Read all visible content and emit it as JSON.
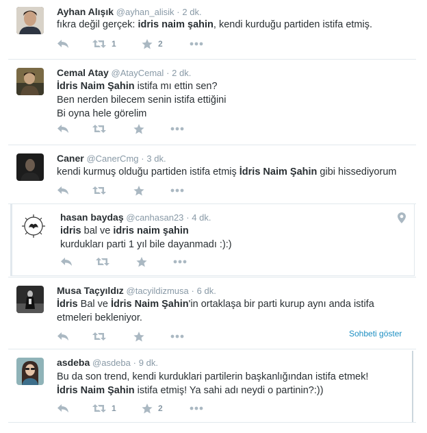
{
  "tweets": [
    {
      "name": "Ayhan Alışık",
      "handle": "@ayhan_alisik",
      "time": "2 dk.",
      "lines": [
        [
          {
            "t": "fıkra değil gerçek: ",
            "b": false
          },
          {
            "t": "idris naim şahin",
            "b": true
          },
          {
            "t": ", kendi kurduğu partiden istifa etmiş.",
            "b": false
          }
        ]
      ],
      "retweets": "1",
      "favorites": "2"
    },
    {
      "name": "Cemal Atay",
      "handle": "@AtayCemal",
      "time": "2 dk.",
      "lines": [
        [
          {
            "t": "İdris Naim Şahin",
            "b": true
          },
          {
            "t": " istifa mı ettin sen?",
            "b": false
          }
        ],
        [
          {
            "t": "Ben nerden bilecem senin istifa ettiğini",
            "b": false
          }
        ],
        [
          {
            "t": "Bi oyna hele görelim",
            "b": false
          }
        ]
      ],
      "retweets": "",
      "favorites": ""
    },
    {
      "name": "Caner",
      "handle": "@CanerCmg",
      "time": "3 dk.",
      "lines": [
        [
          {
            "t": "kendi kurmuş olduğu partiden istifa etmiş ",
            "b": false
          },
          {
            "t": "İdris Naim Şahin",
            "b": true
          },
          {
            "t": " gibi hissediyorum",
            "b": false
          }
        ]
      ],
      "retweets": "",
      "favorites": ""
    },
    {
      "name": "hasan baydaş",
      "handle": "@canhasan23",
      "time": "4 dk.",
      "lines": [
        [
          {
            "t": "idris",
            "b": true
          },
          {
            "t": " bal ve ",
            "b": false
          },
          {
            "t": "idris naim şahin",
            "b": true
          }
        ],
        [
          {
            "t": "kurdukları parti 1 yıl bile dayanmadı :):)",
            "b": false
          }
        ]
      ],
      "retweets": "",
      "favorites": ""
    },
    {
      "name": "Musa Taçyıldız",
      "handle": "@tacyildizmusa",
      "time": "6 dk.",
      "lines": [
        [
          {
            "t": "İdris",
            "b": true
          },
          {
            "t": " Bal ve ",
            "b": false
          },
          {
            "t": "İdris Naim Şahin",
            "b": true
          },
          {
            "t": "'in ortaklaşa bir parti kurup aynı anda istifa",
            "b": false
          }
        ],
        [
          {
            "t": "etmeleri bekleniyor.",
            "b": false
          }
        ]
      ],
      "retweets": "",
      "favorites": "",
      "conversation_link": "Sohbeti göster"
    },
    {
      "name": "asdeba",
      "handle": "@asdeba",
      "time": "9 dk.",
      "lines": [
        [
          {
            "t": "Bu da son trend, kendi kurduklari partilerin başkanlığından istifa etmek!",
            "b": false
          }
        ],
        [
          {
            "t": "İdris Naim Şahin",
            "b": true
          },
          {
            "t": " istifa etmiş! Ya sahi adı neydi o partinin?:))",
            "b": false
          }
        ]
      ],
      "retweets": "1",
      "favorites": "2"
    }
  ],
  "separator_dot": "·",
  "colors": {
    "action_icon": "#aab8c2",
    "link": "#1b8ec2",
    "border": "#e1e8ed"
  },
  "icons": {
    "reply": "reply-icon",
    "retweet": "retweet-icon",
    "favorite": "star-icon",
    "more": "more-icon",
    "location": "location-pin-icon"
  }
}
